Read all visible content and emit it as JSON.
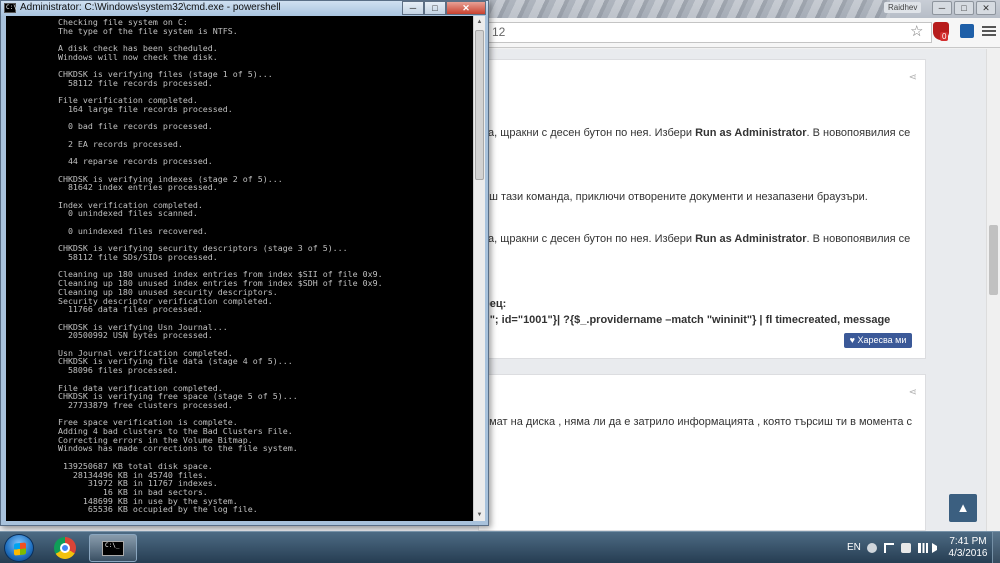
{
  "browser": {
    "user_label": "Raidhev",
    "url_fragment": "12",
    "ext_badge": "0",
    "card1_lines": [
      {
        "pre": "ка, щракни с десен бутон по нея. Избери ",
        "bold": "Run as Administrator",
        "post": ". В новопоявилия се"
      },
      {
        "pre": "иш тази команда, приключи отворените документи и незапазени браузъри.",
        "bold": "",
        "post": ""
      },
      {
        "pre": "ка, щракни с десен бутон по нея. Избери ",
        "bold": "Run as Administrator",
        "post": ". В новопоявилия се"
      },
      {
        "pre": "",
        "bold": "рец:",
        "post": ""
      },
      {
        "pre": "",
        "bold": "n\"; id=\"1001\"}| ?{$_.providername –match \"wininit\"} | fl timecreated, message",
        "post": ""
      }
    ],
    "card2_line": "омат на диска , няма ли да е затрило информацията , която търсиш ти в момента с",
    "like_label": "♥ Харесва ми",
    "scroll_top_glyph": "▲"
  },
  "cmd_window": {
    "title": "Administrator: C:\\Windows\\system32\\cmd.exe - powershell",
    "minimize_glyph": "─",
    "maximize_glyph": "□",
    "close_glyph": "✕",
    "icon_text": "C:\\",
    "console_lines": [
      "          Checking file system on C:",
      "          The type of the file system is NTFS.",
      "",
      "          A disk check has been scheduled.",
      "          Windows will now check the disk.",
      "",
      "          CHKDSK is verifying files (stage 1 of 5)...",
      "            58112 file records processed.",
      "",
      "          File verification completed.",
      "            164 large file records processed.",
      "",
      "            0 bad file records processed.",
      "",
      "            2 EA records processed.",
      "",
      "            44 reparse records processed.",
      "",
      "          CHKDSK is verifying indexes (stage 2 of 5)...",
      "            81642 index entries processed.",
      "",
      "          Index verification completed.",
      "            0 unindexed files scanned.",
      "",
      "            0 unindexed files recovered.",
      "",
      "          CHKDSK is verifying security descriptors (stage 3 of 5)...",
      "            58112 file SDs/SIDs processed.",
      "",
      "          Cleaning up 180 unused index entries from index $SII of file 0x9.",
      "          Cleaning up 180 unused index entries from index $SDH of file 0x9.",
      "          Cleaning up 180 unused security descriptors.",
      "          Security descriptor verification completed.",
      "            11766 data files processed.",
      "",
      "          CHKDSK is verifying Usn Journal...",
      "            20500992 USN bytes processed.",
      "",
      "          Usn Journal verification completed.",
      "          CHKDSK is verifying file data (stage 4 of 5)...",
      "            58096 files processed.",
      "",
      "          File data verification completed.",
      "          CHKDSK is verifying free space (stage 5 of 5)...",
      "            27733879 free clusters processed.",
      "",
      "          Free space verification is complete.",
      "          Adding 4 bad clusters to the Bad Clusters File.",
      "          Correcting errors in the Volume Bitmap.",
      "          Windows has made corrections to the file system.",
      "",
      "           139250687 KB total disk space.",
      "             28134496 KB in 45740 files.",
      "                31972 KB in 11767 indexes.",
      "                   16 KB in bad sectors.",
      "               148699 KB in use by the system.",
      "                65536 KB occupied by the log file."
    ]
  },
  "taskbar": {
    "language": "EN",
    "time": "7:41 PM",
    "date": "4/3/2016",
    "cmd_icon_text": "C:\\_"
  }
}
